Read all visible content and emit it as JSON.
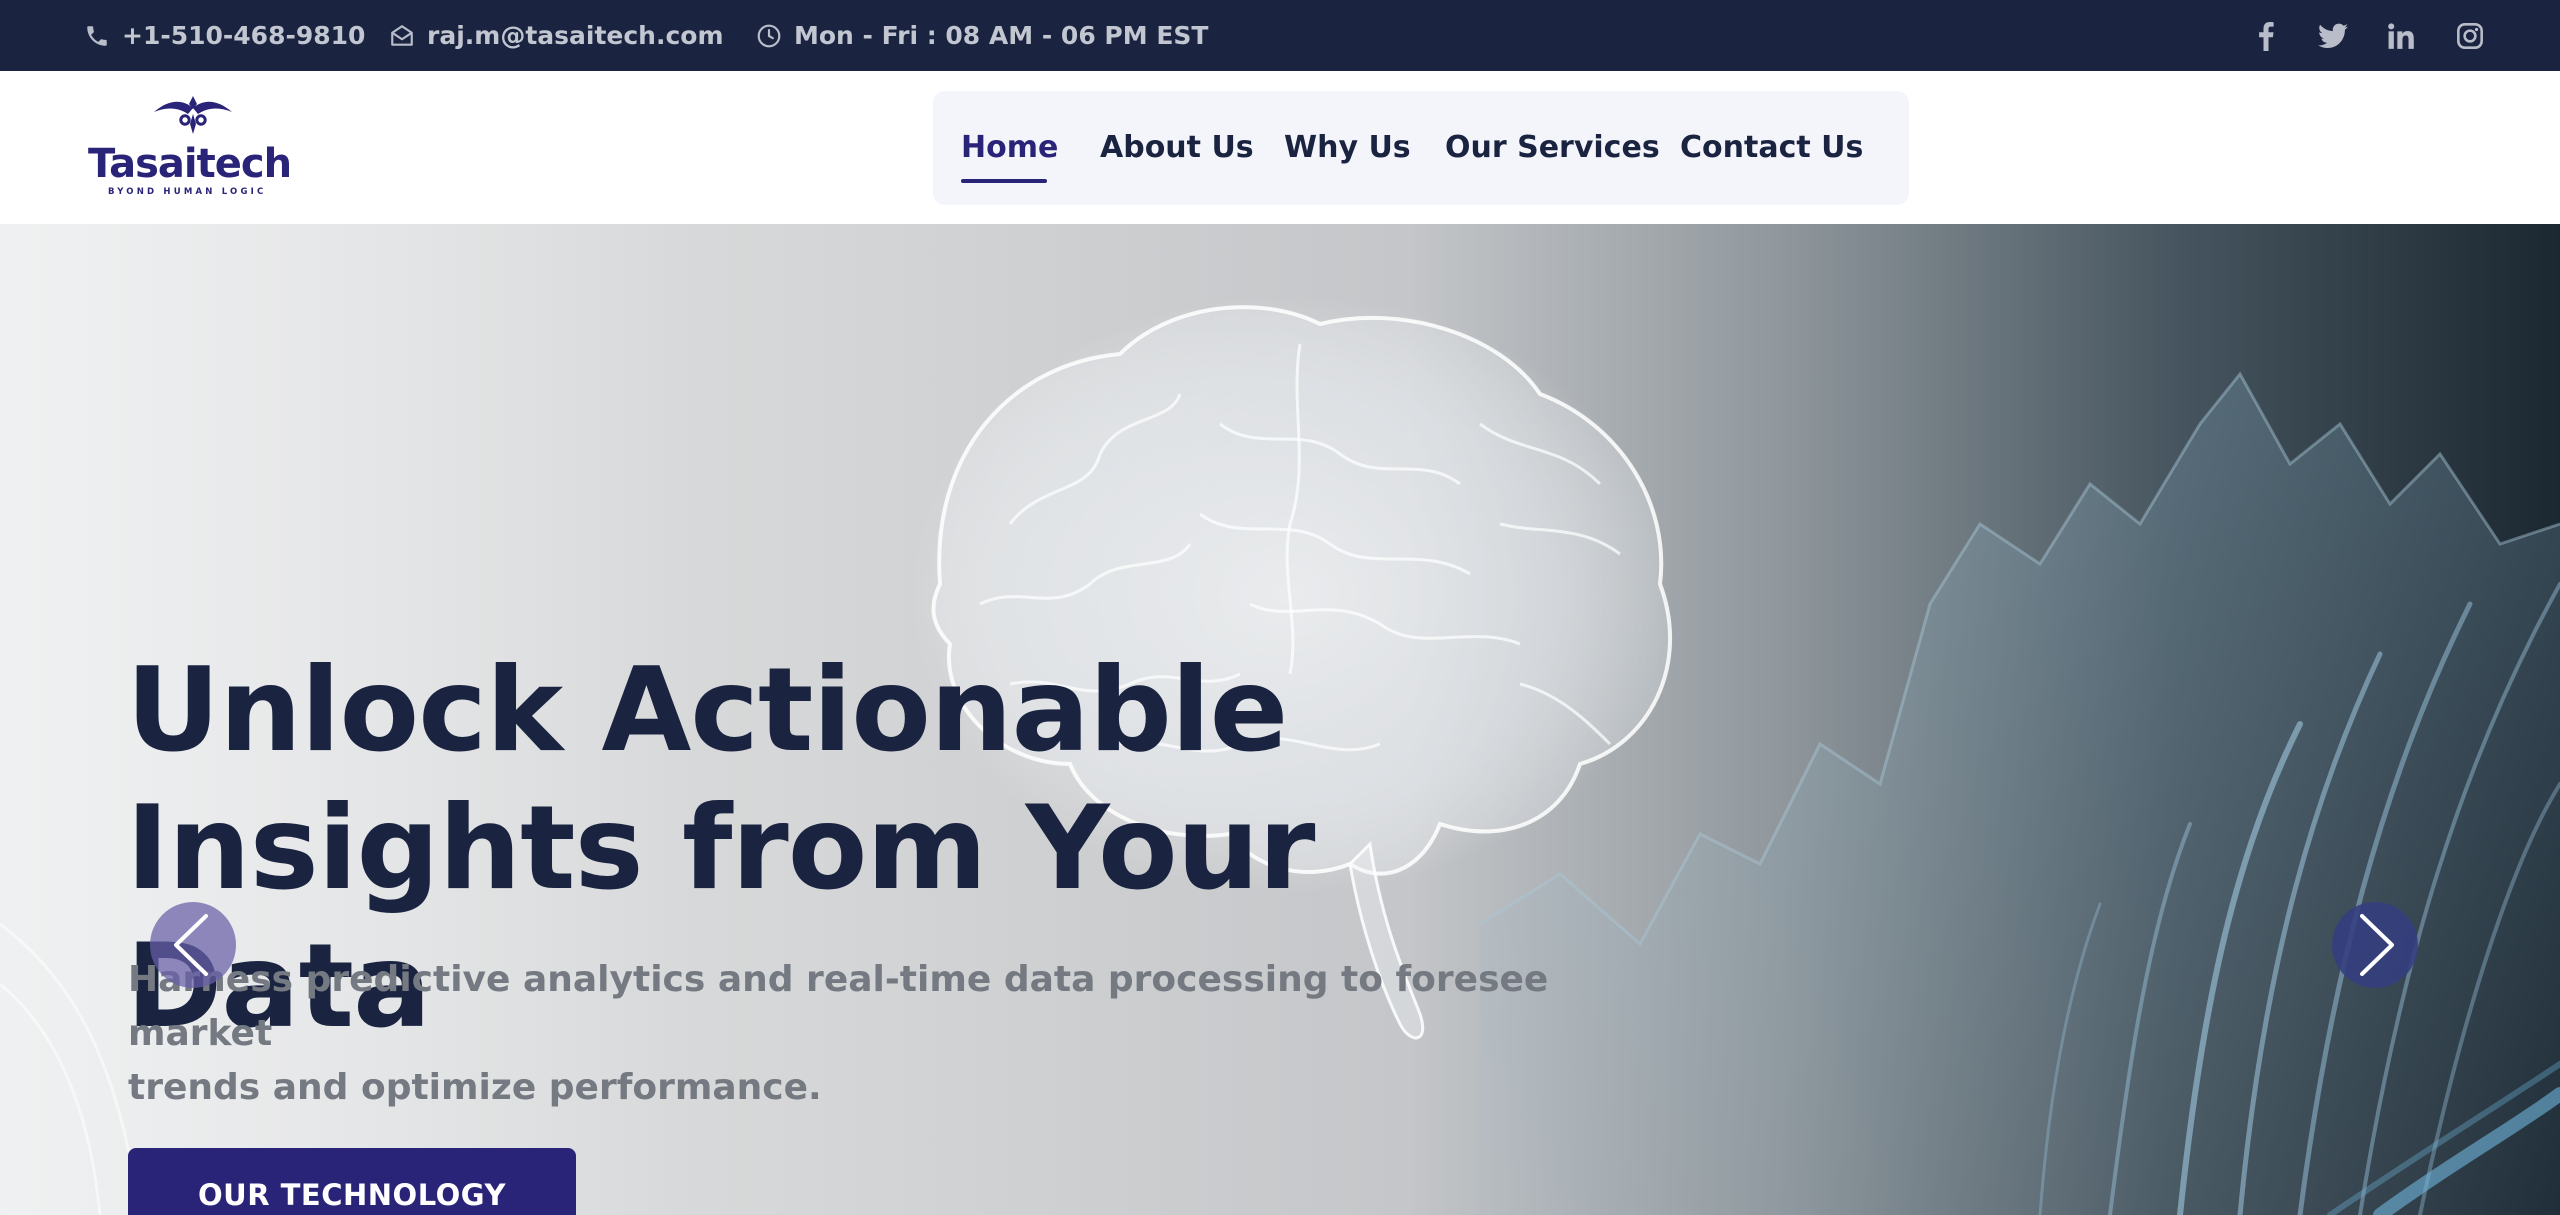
{
  "topbar": {
    "phone": "+1-510-468-9810",
    "email": "raj.m@tasaitech.com",
    "hours": "Mon - Fri : 08 AM - 06 PM EST",
    "social_icons": [
      "facebook-icon",
      "twitter-icon",
      "linkedin-icon",
      "instagram-icon"
    ]
  },
  "brand": {
    "name": "Tasaitech",
    "tagline": "BYOND HUMAN LOGIC"
  },
  "nav": {
    "items": [
      {
        "label": "Home",
        "active": true
      },
      {
        "label": "About Us"
      },
      {
        "label": "Why Us"
      },
      {
        "label": "Our Services"
      },
      {
        "label": "Contact Us"
      }
    ]
  },
  "hero": {
    "title_line1": "Unlock Actionable",
    "title_line2": "Insights from Your Data",
    "subtitle_line1": "Harness predictive analytics and real-time data processing to foresee market",
    "subtitle_line2": "trends and optimize performance.",
    "cta_label": "OUR TECHNOLOGY"
  },
  "colors": {
    "topbar_bg": "#1a2440",
    "brand": "#2a2478",
    "text_dark": "#1a2440",
    "nav_bg": "#f4f5fb",
    "subtitle": "#757a82"
  }
}
